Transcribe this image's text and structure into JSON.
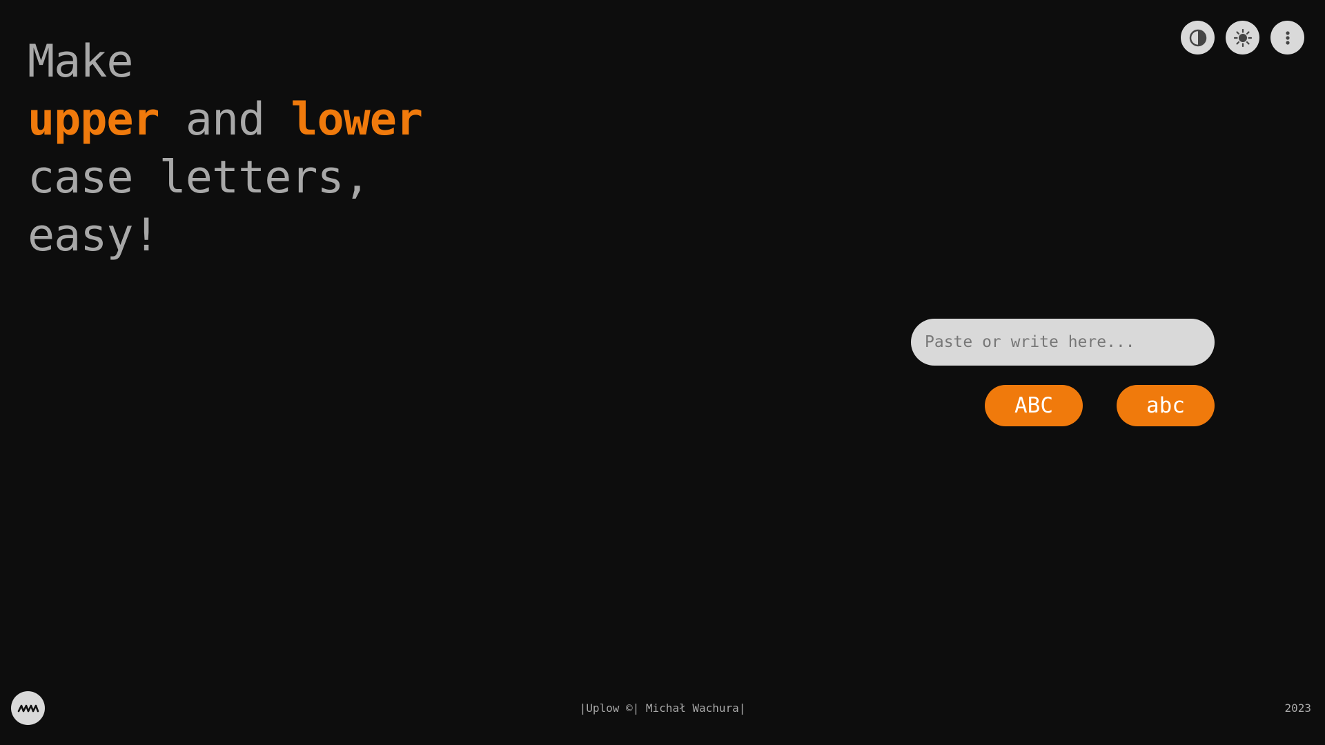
{
  "headline": {
    "line1": "Make",
    "line2_accent1": "upper",
    "line2_middle": " and ",
    "line2_accent2": "lower",
    "line3": "case letters,",
    "line4": "easy!"
  },
  "toolbar": {
    "buttons": [
      {
        "name": "contrast-toggle",
        "icon": "half-circle-contrast-icon"
      },
      {
        "name": "brightness-toggle",
        "icon": "sun-icon"
      },
      {
        "name": "more-menu",
        "icon": "vertical-dots-icon"
      }
    ]
  },
  "converter": {
    "input_placeholder": "Paste or write here...",
    "input_value": "",
    "uppercase_label": "ABC",
    "lowercase_label": "abc"
  },
  "footer": {
    "logo_icon": "mw-logo-icon",
    "credit": "|Uplow ©| Michał Wachura|",
    "year": "2023"
  },
  "colors": {
    "background": "#0d0d0d",
    "accent": "#f07a0c",
    "text_muted": "#a8a8a8",
    "control_bg": "#d9d9d9"
  }
}
